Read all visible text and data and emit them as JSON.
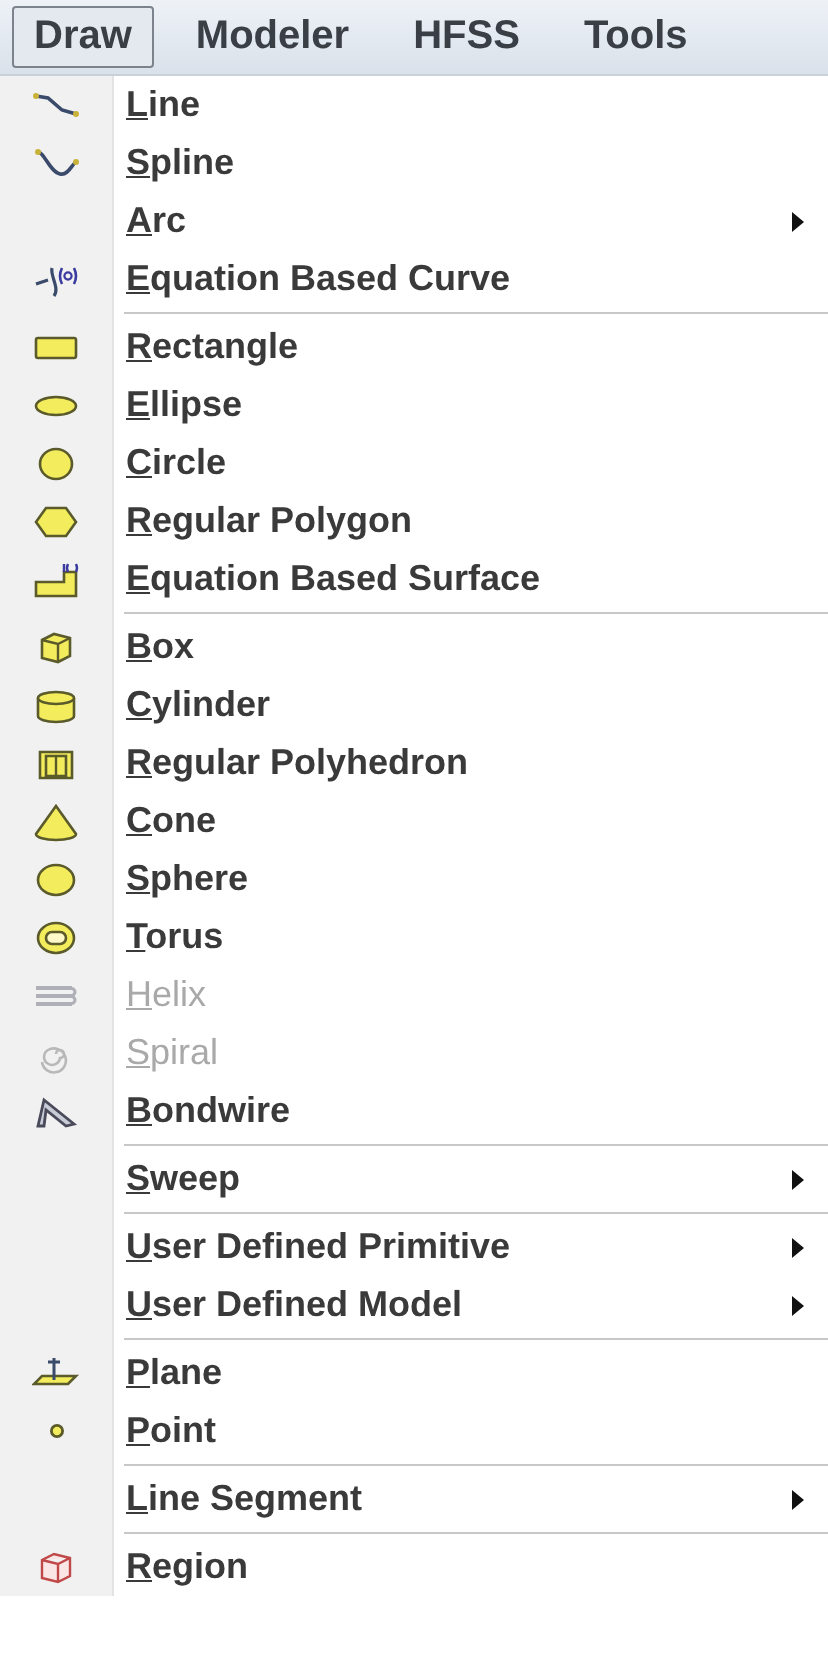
{
  "menubar": [
    {
      "label": "Draw",
      "selected": true
    },
    {
      "label": "Modeler",
      "selected": false
    },
    {
      "label": "HFSS",
      "selected": false
    },
    {
      "label": "Tools",
      "selected": false
    }
  ],
  "menu": {
    "groups": [
      [
        {
          "label": "Line",
          "disabled": false,
          "submenu": false
        },
        {
          "label": "Spline",
          "disabled": false,
          "submenu": false
        },
        {
          "label": "Arc",
          "disabled": false,
          "submenu": true
        },
        {
          "label": "Equation Based Curve",
          "disabled": false,
          "submenu": false
        }
      ],
      [
        {
          "label": "Rectangle",
          "disabled": false,
          "submenu": false
        },
        {
          "label": "Ellipse",
          "disabled": false,
          "submenu": false
        },
        {
          "label": "Circle",
          "disabled": false,
          "submenu": false
        },
        {
          "label": "Regular Polygon",
          "disabled": false,
          "submenu": false
        },
        {
          "label": "Equation Based Surface",
          "disabled": false,
          "submenu": false
        }
      ],
      [
        {
          "label": "Box",
          "disabled": false,
          "submenu": false
        },
        {
          "label": "Cylinder",
          "disabled": false,
          "submenu": false
        },
        {
          "label": "Regular Polyhedron",
          "disabled": false,
          "submenu": false
        },
        {
          "label": "Cone",
          "disabled": false,
          "submenu": false
        },
        {
          "label": "Sphere",
          "disabled": false,
          "submenu": false
        },
        {
          "label": "Torus",
          "disabled": false,
          "submenu": false
        },
        {
          "label": "Helix",
          "disabled": true,
          "submenu": false
        },
        {
          "label": "Spiral",
          "disabled": true,
          "submenu": false
        },
        {
          "label": "Bondwire",
          "disabled": false,
          "submenu": false
        }
      ],
      [
        {
          "label": "Sweep",
          "disabled": false,
          "submenu": true
        }
      ],
      [
        {
          "label": "User Defined Primitive",
          "disabled": false,
          "submenu": true
        },
        {
          "label": "User Defined Model",
          "disabled": false,
          "submenu": true
        }
      ],
      [
        {
          "label": "Plane",
          "disabled": false,
          "submenu": false
        },
        {
          "label": "Point",
          "disabled": false,
          "submenu": false
        }
      ],
      [
        {
          "label": "Line Segment",
          "disabled": false,
          "submenu": true
        }
      ],
      [
        {
          "label": "Region",
          "disabled": false,
          "submenu": false
        }
      ]
    ]
  }
}
